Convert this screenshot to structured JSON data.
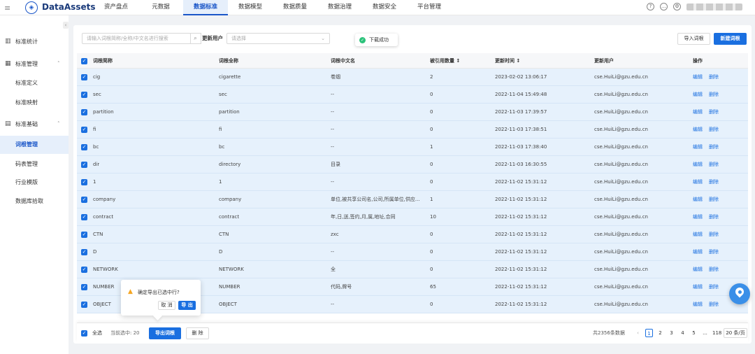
{
  "app": {
    "brand": "DataAssets",
    "logo_glyph": "◈"
  },
  "nav": [
    {
      "label": "资产盘点",
      "active": false
    },
    {
      "label": "元数据",
      "active": false
    },
    {
      "label": "数据标准",
      "active": true
    },
    {
      "label": "数据模型",
      "active": false
    },
    {
      "label": "数据质量",
      "active": false
    },
    {
      "label": "数据治理",
      "active": false
    },
    {
      "label": "数据安全",
      "active": false
    },
    {
      "label": "平台管理",
      "active": false
    }
  ],
  "sidebar": {
    "groups": [
      {
        "label": "标准统计",
        "icon": "chart-icon"
      },
      {
        "label": "标准管理",
        "icon": "grid-icon",
        "expanded": true
      },
      {
        "label": "标准基础",
        "icon": "table-icon",
        "expanded": true
      }
    ],
    "items": [
      {
        "label": "标准定义",
        "active": false
      },
      {
        "label": "标准映射",
        "active": false
      },
      {
        "label": "词根管理",
        "active": true
      },
      {
        "label": "码表管理",
        "active": false
      },
      {
        "label": "行业模版",
        "active": false
      },
      {
        "label": "数据库拾取",
        "active": false
      }
    ]
  },
  "toolbar": {
    "search_placeholder": "请输入词根简称/全称/中文名进行搜索",
    "user_label": "更新用户",
    "user_placeholder": "请选择",
    "toast": "下载成功",
    "import_label": "导入词根",
    "new_label": "新建词根"
  },
  "table": {
    "columns": [
      "词根简称",
      "词根全称",
      "词根中文名",
      "被引用数量 ↕",
      "更新时间 ↕",
      "更新用户",
      "操作"
    ],
    "edit_label": "编辑",
    "delete_label": "删除",
    "rows": [
      {
        "abbr": "cig",
        "full": "cigarette",
        "cn": "卷烟",
        "refs": "2",
        "time": "2023-02-02 13:06:17",
        "user": "cse.HuiLi@gzu.edu.cn"
      },
      {
        "abbr": "sec",
        "full": "sec",
        "cn": "--",
        "refs": "0",
        "time": "2022-11-04 15:49:48",
        "user": "cse.HuiLi@gzu.edu.cn"
      },
      {
        "abbr": "partition",
        "full": "partition",
        "cn": "--",
        "refs": "0",
        "time": "2022-11-03 17:39:57",
        "user": "cse.HuiLi@gzu.edu.cn"
      },
      {
        "abbr": "fi",
        "full": "fi",
        "cn": "--",
        "refs": "0",
        "time": "2022-11-03 17:38:51",
        "user": "cse.HuiLi@gzu.edu.cn"
      },
      {
        "abbr": "bc",
        "full": "bc",
        "cn": "--",
        "refs": "1",
        "time": "2022-11-03 17:38:40",
        "user": "cse.HuiLi@gzu.edu.cn"
      },
      {
        "abbr": "dir",
        "full": "directory",
        "cn": "目录",
        "refs": "0",
        "time": "2022-11-03 16:30:55",
        "user": "cse.HuiLi@gzu.edu.cn"
      },
      {
        "abbr": "1",
        "full": "1",
        "cn": "--",
        "refs": "0",
        "time": "2022-11-02 15:31:12",
        "user": "cse.HuiLi@gzu.edu.cn"
      },
      {
        "abbr": "company",
        "full": "company",
        "cn": "单位,被共享公司名,公司,所属单位,供应...",
        "refs": "1",
        "time": "2022-11-02 15:31:12",
        "user": "cse.HuiLi@gzu.edu.cn"
      },
      {
        "abbr": "contract",
        "full": "contract",
        "cn": "年,日,送,签约,月,属,地址,合同",
        "refs": "10",
        "time": "2022-11-02 15:31:12",
        "user": "cse.HuiLi@gzu.edu.cn"
      },
      {
        "abbr": "CTN",
        "full": "CTN",
        "cn": "zxc",
        "refs": "0",
        "time": "2022-11-02 15:31:12",
        "user": "cse.HuiLi@gzu.edu.cn"
      },
      {
        "abbr": "D",
        "full": "D",
        "cn": "--",
        "refs": "0",
        "time": "2022-11-02 15:31:12",
        "user": "cse.HuiLi@gzu.edu.cn"
      },
      {
        "abbr": "NETWORK",
        "full": "NETWORK",
        "cn": "全",
        "refs": "0",
        "time": "2022-11-02 15:31:12",
        "user": "cse.HuiLi@gzu.edu.cn"
      },
      {
        "abbr": "NUMBER",
        "full": "NUMBER",
        "cn": "代码,牌号",
        "refs": "65",
        "time": "2022-11-02 15:31:12",
        "user": "cse.HuiLi@gzu.edu.cn"
      },
      {
        "abbr": "OBJECT",
        "full": "OBJECT",
        "cn": "--",
        "refs": "0",
        "time": "2022-11-02 15:31:12",
        "user": "cse.HuiLi@gzu.edu.cn"
      }
    ]
  },
  "footer": {
    "select_all": "全选",
    "selected_text": "当前选中: 20",
    "export_label": "导出词根",
    "delete_label": "删 除",
    "total": "共2356条数据",
    "pages": [
      "1",
      "2",
      "3",
      "4",
      "5",
      "...",
      "118"
    ],
    "current_page": "1",
    "page_size": "20 条/页"
  },
  "popconfirm": {
    "message": "确定导出已选中行?",
    "cancel": "取 消",
    "ok": "导 出"
  }
}
